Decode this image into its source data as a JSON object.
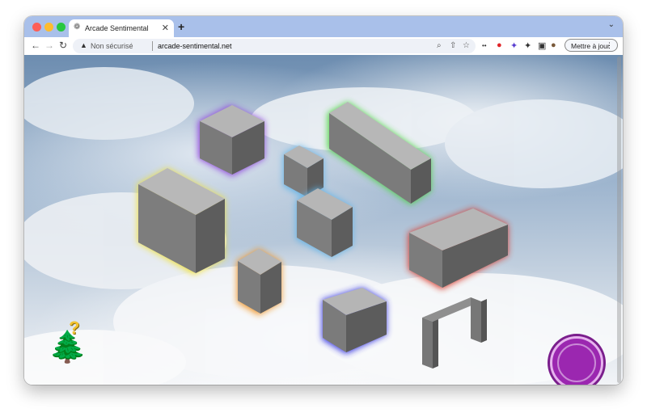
{
  "browser": {
    "tab_title": "Arcade Sentimental",
    "tab_favicon": "❁",
    "close_glyph": "✕",
    "new_tab_glyph": "+",
    "tab_menu_glyph": "⌄",
    "back_glyph": "←",
    "forward_glyph": "→",
    "reload_glyph": "↻",
    "warning_glyph": "▲",
    "security_label": "Non sécurisé",
    "url": "arcade-sentimental.net",
    "zoom_glyph": "⌕",
    "share_glyph": "⇧",
    "star_glyph": "☆",
    "ext_glyphs": [
      "••",
      "●",
      "✦",
      "✦",
      "▣",
      "●"
    ],
    "update_label": "Mettre à jour",
    "menu_glyph": "⋮"
  },
  "game": {
    "tree_glyph": "🌲",
    "hint_glyph": "?",
    "blocks": [
      {
        "name": "purple-block",
        "color": "#8a3bdc"
      },
      {
        "name": "green-block",
        "color": "#46d63a"
      },
      {
        "name": "blue-small-block",
        "color": "#5fb3e8"
      },
      {
        "name": "blue-tall-block",
        "color": "#5fb3e8"
      },
      {
        "name": "yellow-block",
        "color": "#f0e030"
      },
      {
        "name": "red-block",
        "color": "#d83020"
      },
      {
        "name": "orange-block",
        "color": "#f0901a"
      },
      {
        "name": "navy-block",
        "color": "#2a2ae0"
      }
    ],
    "action_button_color": "#9b27b0"
  }
}
